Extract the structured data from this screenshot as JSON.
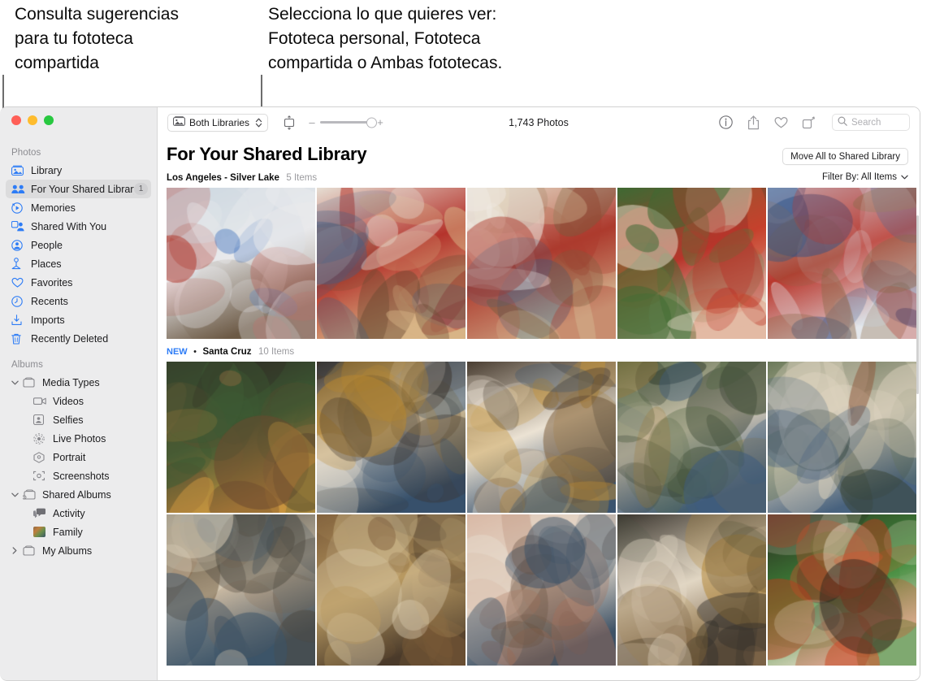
{
  "annotations": [
    {
      "id": "anno-hint-suggestions",
      "text": "Consulta sugerencias\npara tu fototeca\ncompartida"
    },
    {
      "id": "anno-hint-library-picker",
      "text": "Selecciona lo que quieres ver:\nFototeca personal, Fototeca\ncompartida o Ambas fototecas."
    }
  ],
  "window": {
    "traffic_lights": [
      "close",
      "minimize",
      "zoom"
    ]
  },
  "sidebar": {
    "groups": [
      {
        "title": "Photos",
        "items": [
          {
            "label": "Library",
            "icon": "library-icon",
            "selected": false,
            "badge": ""
          },
          {
            "label": "For Your Shared Library",
            "icon": "people-shared-icon",
            "selected": true,
            "badge": "1"
          },
          {
            "label": "Memories",
            "icon": "memories-icon",
            "selected": false,
            "badge": ""
          },
          {
            "label": "Shared With You",
            "icon": "shared-with-you-icon",
            "selected": false,
            "badge": ""
          },
          {
            "label": "People",
            "icon": "person-icon",
            "selected": false,
            "badge": ""
          },
          {
            "label": "Places",
            "icon": "places-pin-icon",
            "selected": false,
            "badge": ""
          },
          {
            "label": "Favorites",
            "icon": "heart-icon",
            "selected": false,
            "badge": ""
          },
          {
            "label": "Recents",
            "icon": "clock-icon",
            "selected": false,
            "badge": ""
          },
          {
            "label": "Imports",
            "icon": "import-icon",
            "selected": false,
            "badge": ""
          },
          {
            "label": "Recently Deleted",
            "icon": "trash-icon",
            "selected": false,
            "badge": ""
          }
        ]
      },
      {
        "title": "Albums",
        "items": [
          {
            "label": "Media Types",
            "icon": "album-icon",
            "selected": false,
            "badge": "",
            "level": "group",
            "expanded": true
          },
          {
            "label": "Videos",
            "icon": "video-icon",
            "selected": false,
            "badge": "",
            "level": "sub"
          },
          {
            "label": "Selfies",
            "icon": "selfie-icon",
            "selected": false,
            "badge": "",
            "level": "sub"
          },
          {
            "label": "Live Photos",
            "icon": "live-photo-icon",
            "selected": false,
            "badge": "",
            "level": "sub"
          },
          {
            "label": "Portrait",
            "icon": "portrait-icon",
            "selected": false,
            "badge": "",
            "level": "sub"
          },
          {
            "label": "Screenshots",
            "icon": "screenshot-icon",
            "selected": false,
            "badge": "",
            "level": "sub"
          },
          {
            "label": "Shared Albums",
            "icon": "shared-album-icon",
            "selected": false,
            "badge": "",
            "level": "group",
            "expanded": true
          },
          {
            "label": "Activity",
            "icon": "activity-icon",
            "selected": false,
            "badge": "",
            "level": "sub"
          },
          {
            "label": "Family",
            "icon": "family-thumb-icon",
            "selected": false,
            "badge": "",
            "level": "sub"
          },
          {
            "label": "My Albums",
            "icon": "album-icon",
            "selected": false,
            "badge": "",
            "level": "group",
            "expanded": false
          }
        ]
      }
    ]
  },
  "toolbar": {
    "library_selector": "Both Libraries",
    "zoom_minus": "–",
    "zoom_plus": "+",
    "photo_count": "1,743 Photos",
    "icons": [
      "info-icon",
      "share-icon",
      "favorite-heart-icon",
      "rotate-icon"
    ],
    "search_placeholder": "Search",
    "search_value": ""
  },
  "content": {
    "page_title": "For Your Shared Library",
    "move_all_button": "Move All to Shared Library",
    "filter_label": "Filter By: All Items",
    "sections": [
      {
        "new_tag": "",
        "title": "Los Angeles - Silver Lake",
        "count": "5 Items"
      },
      {
        "new_tag": "NEW",
        "separator": "•",
        "title": "Santa Cruz",
        "count": "10 Items"
      }
    ]
  },
  "colors": {
    "accent_blue": "#2d7cf6",
    "sidebar_bg": "#ececed",
    "selection_bg": "#dcdcdd"
  }
}
